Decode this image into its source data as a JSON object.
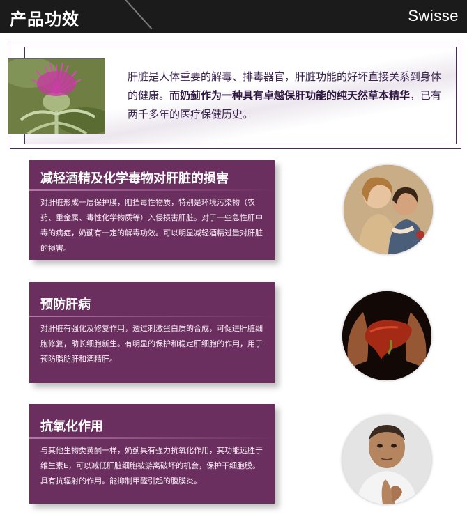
{
  "header": {
    "title": "产品功效",
    "brand": "Swisse"
  },
  "intro": {
    "text_normal": "肝脏是人体重要的解毒、排毒器官，肝脏功能的好坏直接关系到身体的健康。",
    "text_bold": "而奶蓟作为一种具有卓越保肝功能的纯天然草本精华",
    "text_tail": "，已有两千多年的医疗保健历史。"
  },
  "cards": [
    {
      "title": "减轻酒精及化学毒物对肝脏的损害",
      "body": "对肝脏形成一层保护膜，阻挡毒性物质，特别是环境污染物（农药、重金属、毒性化学物质等）入侵损害肝脏。对于一些急性肝中毒的病症，奶蓟有一定的解毒功效。可以明显减轻酒精过量对肝脏的损害。"
    },
    {
      "title": "预防肝病",
      "body": "对肝脏有强化及修复作用，透过刺激蛋白质的合成，可促进肝脏细胞修复，助长细胞新生。有明显的保护和稳定肝细胞的作用，用于预防脂肪肝和酒精肝。"
    },
    {
      "title": "抗氧化作用",
      "body": "与其他生物类黄酮一样，奶蓟具有强力抗氧化作用，其功能远胜于维生素E，可以减低肝脏细胞被游离破坏的机会，保护干细胞膜。具有抗辐射的作用。能抑制甲醛引起的腹膜炎。"
    }
  ]
}
